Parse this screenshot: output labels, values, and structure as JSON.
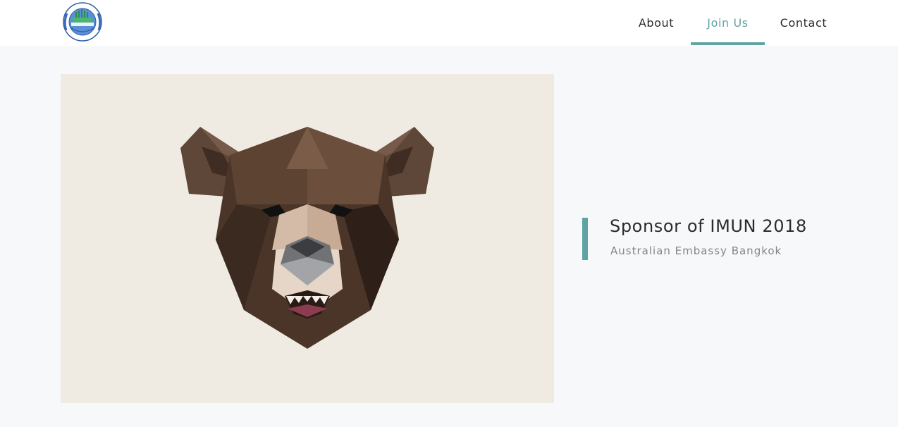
{
  "nav": {
    "items": [
      {
        "label": "About"
      },
      {
        "label": "Join Us",
        "active": true
      },
      {
        "label": "Contact"
      }
    ]
  },
  "logo": {
    "icon": "un-globe-logo-icon"
  },
  "hero": {
    "image_icon": "low-poly-bear-head-illustration",
    "title": "Sponsor of IMUN 2018",
    "subtitle": "Australian Embassy Bangkok"
  },
  "colors": {
    "accent": "#5fa3a3",
    "page_bg": "#f7f8f9",
    "image_bg": "#efebe2",
    "text": "#2b2b2b",
    "muted": "#858585"
  }
}
